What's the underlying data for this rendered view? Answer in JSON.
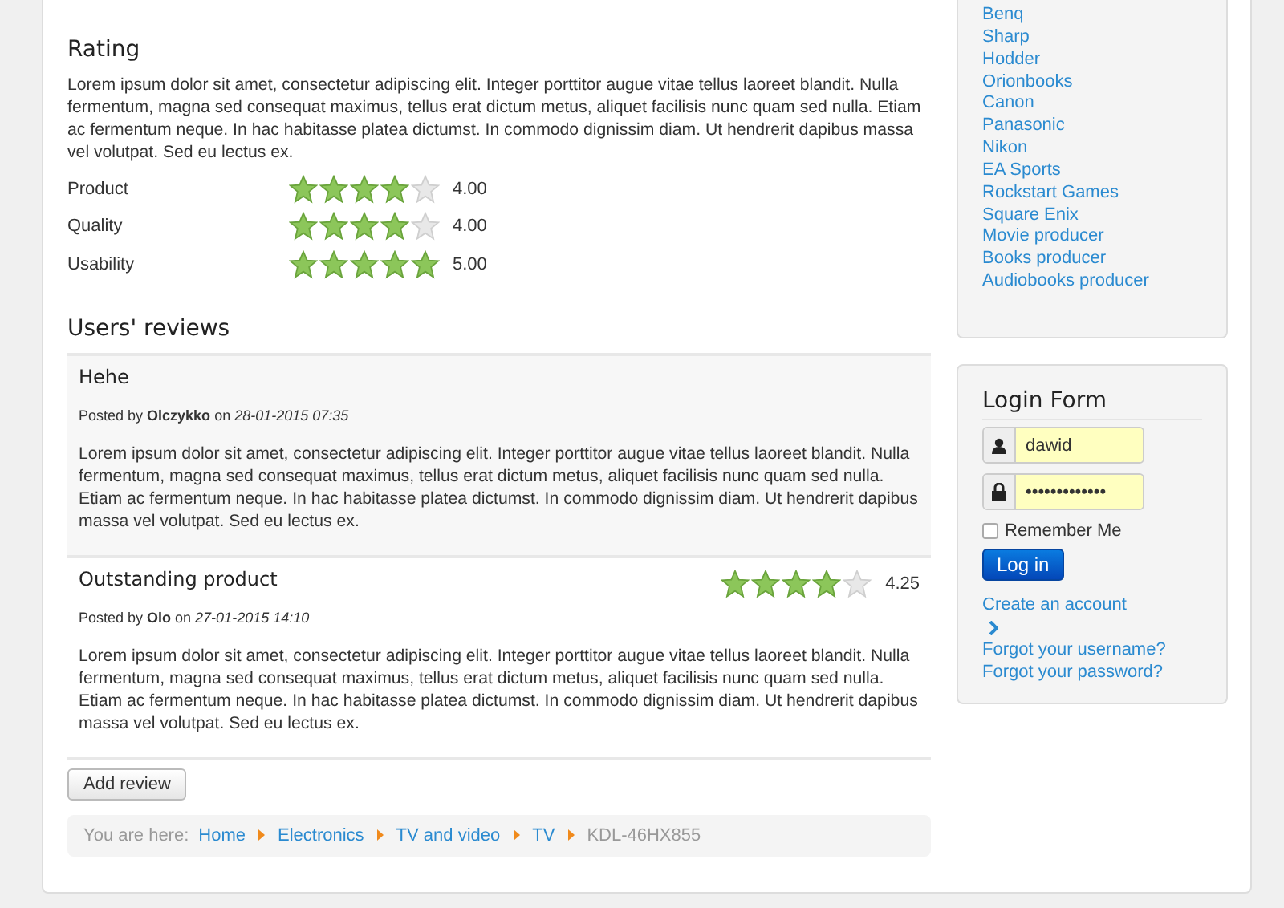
{
  "rating": {
    "title": "Rating",
    "text": "Lorem ipsum dolor sit amet, consectetur adipiscing elit. Integer porttitor augue vitae tellus laoreet blandit. Nulla fermentum, magna sed consequat maximus, tellus erat dictum metus, aliquet facilisis nunc quam sed nulla. Etiam ac fermentum neque. In hac habitasse platea dictumst. In commodo dignissim diam. Ut hendrerit dapibus massa vel volutpat. Sed eu lectus ex.",
    "items": [
      {
        "label": "Product",
        "stars": 4,
        "reading": "4.00"
      },
      {
        "label": "Quality",
        "stars": 4,
        "reading": "4.00"
      },
      {
        "label": "Usability",
        "stars": 5,
        "reading": "5.00"
      }
    ]
  },
  "reviews": {
    "title": "Users' reviews",
    "items": [
      {
        "title": "Hehe",
        "posted_by": "Posted by",
        "author": "Olczykko",
        "on": "on",
        "date": "28-01-2015 07:35",
        "text": "Lorem ipsum dolor sit amet, consectetur adipiscing elit. Integer porttitor augue vitae tellus laoreet blandit. Nulla fermentum, magna sed consequat maximus, tellus erat dictum metus, aliquet facilisis nunc quam sed nulla. Etiam ac fermentum neque. In hac habitasse platea dictumst. In commodo dignissim diam. Ut hendrerit dapibus massa vel volutpat. Sed eu lectus ex."
      },
      {
        "title": "Outstanding product",
        "stars": 4,
        "reading": "4.25",
        "posted_by": "Posted by",
        "author": "Olo",
        "on": "on",
        "date": "27-01-2015 14:10",
        "text": "Lorem ipsum dolor sit amet, consectetur adipiscing elit. Integer porttitor augue vitae tellus laoreet blandit. Nulla fermentum, magna sed consequat maximus, tellus erat dictum metus, aliquet facilisis nunc quam sed nulla. Etiam ac fermentum neque. In hac habitasse platea dictumst. In commodo dignissim diam. Ut hendrerit dapibus massa vel volutpat. Sed eu lectus ex."
      }
    ],
    "add_button": "Add review"
  },
  "breadcrumb": {
    "prefix": "You are here:",
    "items": [
      {
        "label": "Home",
        "kind": "link"
      },
      {
        "label": "Electronics",
        "kind": "link"
      },
      {
        "label": "TV and video",
        "kind": "link"
      },
      {
        "label": "TV",
        "kind": "link"
      },
      {
        "label": "KDL-46HX855",
        "kind": "current"
      }
    ]
  },
  "manufacturers": [
    "Benq",
    "Sharp",
    "Hodder",
    "Orionbooks",
    "Canon",
    "Panasonic",
    "Nikon",
    "EA Sports",
    "Rockstart Games",
    "Square Enix",
    "Movie producer",
    "Books producer",
    "Audiobooks producer"
  ],
  "login": {
    "title": "Login Form",
    "username": "dawid",
    "password": "•••••••••••••",
    "remember": {
      "label": "Remember Me",
      "checked": false
    },
    "button": "Log in",
    "links": [
      "Create an account",
      "Forgot your username?",
      "Forgot your password?"
    ]
  }
}
